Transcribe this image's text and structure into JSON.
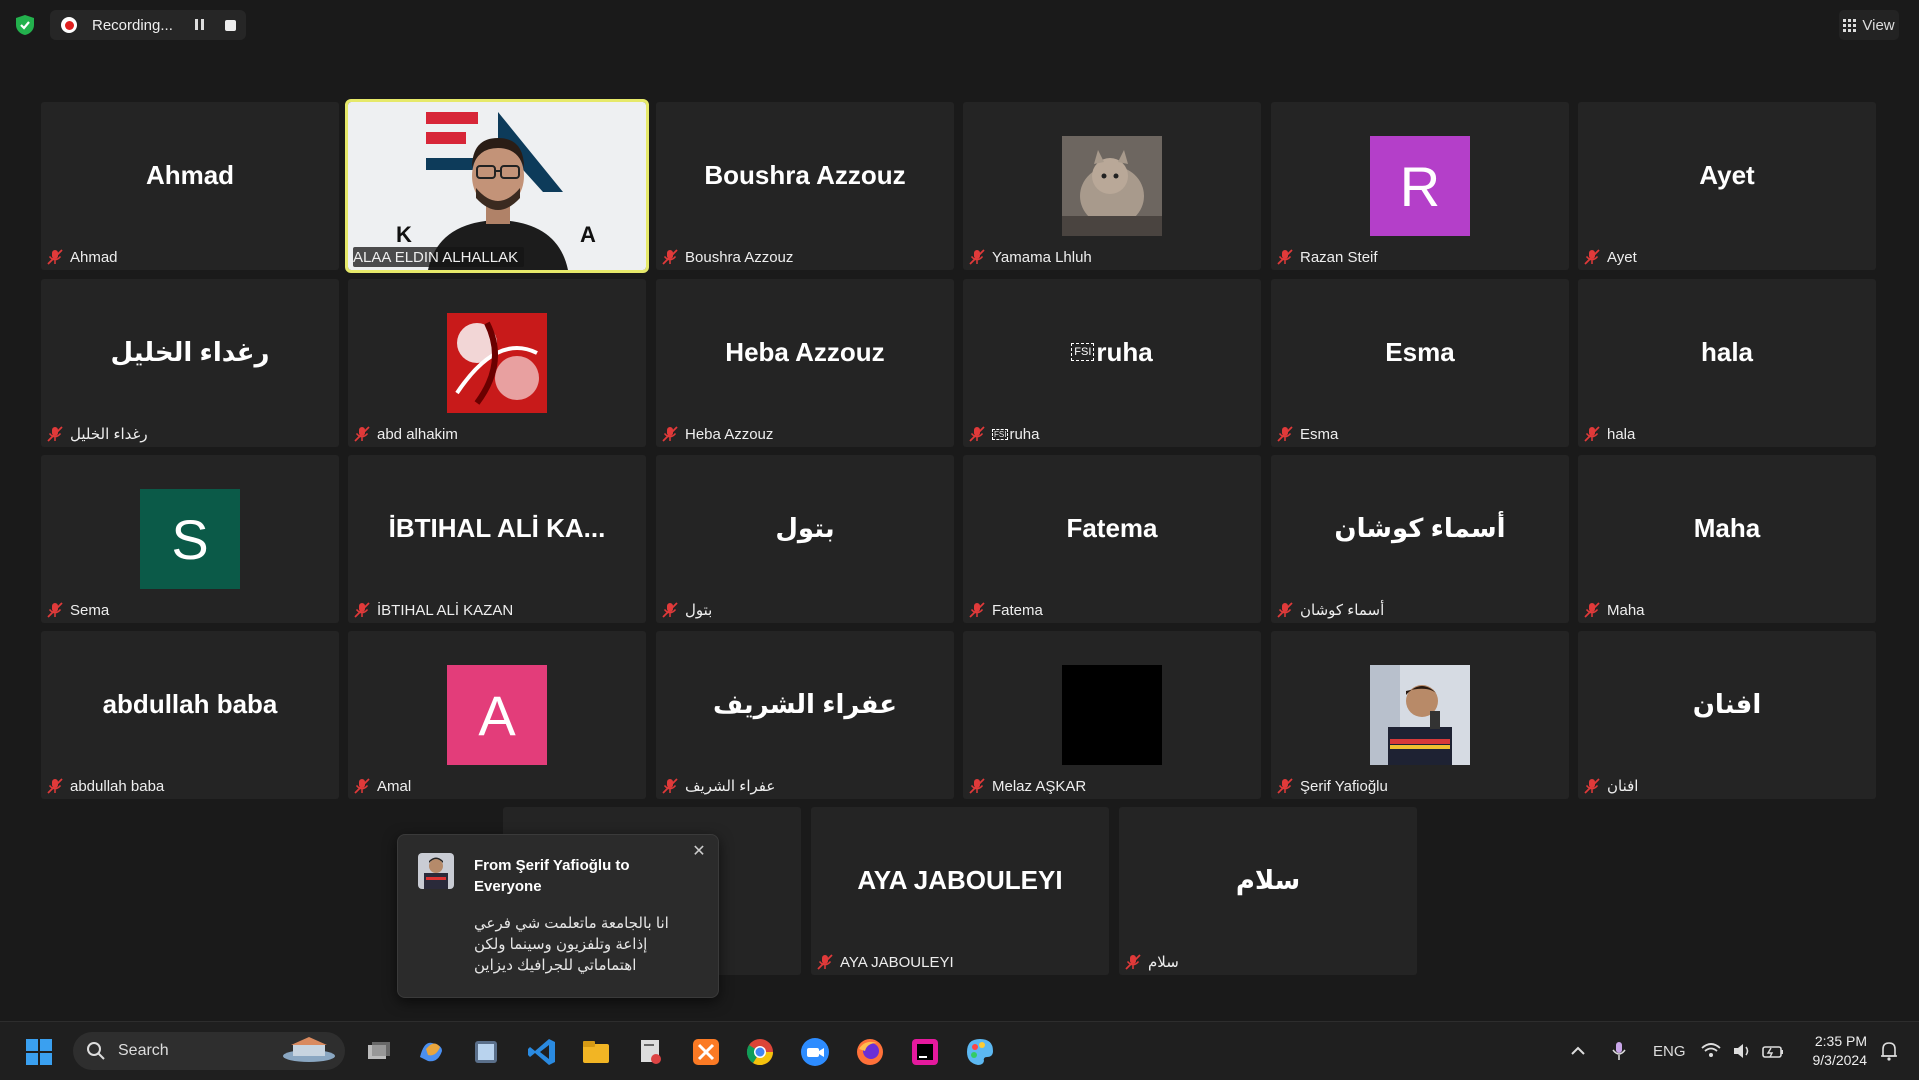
{
  "toolbar": {
    "recording_label": "Recording...",
    "view_label": "View"
  },
  "participants": [
    {
      "center": "Ahmad",
      "label": "Ahmad"
    },
    {
      "center": "",
      "label": "ALAA ELDIN ALHALLAK",
      "video": true
    },
    {
      "center": "Boushra Azzouz",
      "label": "Boushra Azzouz"
    },
    {
      "center": "",
      "label": "Yamama Lhluh",
      "photo": "cat"
    },
    {
      "center": "R",
      "label": "Razan Steif",
      "avatar_color": "#b43fc9"
    },
    {
      "center": "Ayet",
      "label": "Ayet"
    },
    {
      "center": "رغداء الخليل",
      "label": "رغداء الخليل"
    },
    {
      "center": "",
      "label": "abd alhakim",
      "photo": "red-art"
    },
    {
      "center": "Heba Azzouz",
      "label": "Heba Azzouz"
    },
    {
      "center": "ruha",
      "label": "ruha",
      "fsi": true
    },
    {
      "center": "Esma",
      "label": "Esma"
    },
    {
      "center": "hala",
      "label": "hala"
    },
    {
      "center": "S",
      "label": "Sema",
      "avatar_color": "#0b5a48"
    },
    {
      "center": "İBTIHAL ALİ KA...",
      "label": "İBTIHAL ALİ KAZAN"
    },
    {
      "center": "بتول",
      "label": "بتول"
    },
    {
      "center": "Fatema",
      "label": "Fatema"
    },
    {
      "center": "أسماء كوشان",
      "label": "أسماء كوشان"
    },
    {
      "center": "Maha",
      "label": "Maha"
    },
    {
      "center": "abdullah baba",
      "label": "abdullah baba"
    },
    {
      "center": "A",
      "label": "Amal",
      "avatar_color": "#e33d7a"
    },
    {
      "center": "عفراء الشريف",
      "label": "عفراء الشريف"
    },
    {
      "center": "",
      "label": "Melaz AŞKAR",
      "photo": "black"
    },
    {
      "center": "",
      "label": "Şerif Yafioğlu",
      "photo": "selfie"
    },
    {
      "center": "افنان",
      "label": "افنان"
    },
    {
      "center": "",
      "label": ""
    },
    {
      "center": "AYA JABOULEYI",
      "label": "AYA JABOULEYI"
    },
    {
      "center": "سلام",
      "label": "سلام"
    }
  ],
  "video_tile": {
    "logo_left": "K",
    "logo_right": "A"
  },
  "fsi_tag": "FSI",
  "chat_popup": {
    "title": "From Şerif Yafioğlu to Everyone",
    "message": "انا بالجامعة ماتعلمت شي فرعي إذاعة وتلفزيون وسينما ولكن اهتماماتي للجرافيك ديزاين"
  },
  "taskbar": {
    "search_placeholder": "Search",
    "language": "ENG",
    "time": "2:35 PM",
    "date": "9/3/2024"
  }
}
